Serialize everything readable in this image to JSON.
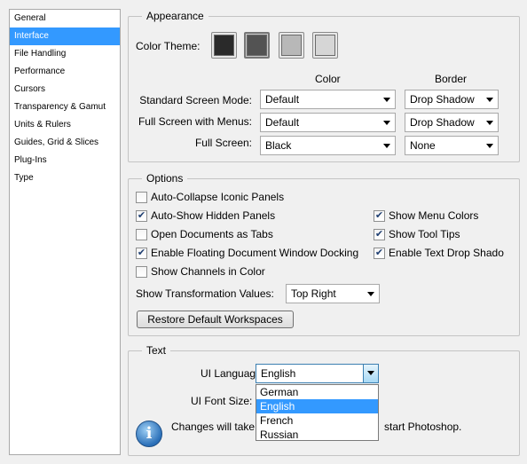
{
  "sidebar": {
    "items": [
      {
        "label": "General"
      },
      {
        "label": "Interface"
      },
      {
        "label": "File Handling"
      },
      {
        "label": "Performance"
      },
      {
        "label": "Cursors"
      },
      {
        "label": "Transparency & Gamut"
      },
      {
        "label": "Units & Rulers"
      },
      {
        "label": "Guides, Grid & Slices"
      },
      {
        "label": "Plug-Ins"
      },
      {
        "label": "Type"
      }
    ],
    "selected_index": 1
  },
  "appearance": {
    "title": "Appearance",
    "color_theme_label": "Color Theme:",
    "themes": [
      "#2a2a2a",
      "#535353",
      "#b8b8b8",
      "#d6d6d6"
    ],
    "selected_theme": 1,
    "col_color": "Color",
    "col_border": "Border",
    "rows": [
      {
        "label": "Standard Screen Mode:",
        "color": "Default",
        "border": "Drop Shadow"
      },
      {
        "label": "Full Screen with Menus:",
        "color": "Default",
        "border": "Drop Shadow"
      },
      {
        "label": "Full Screen:",
        "color": "Black",
        "border": "None"
      }
    ]
  },
  "options": {
    "title": "Options",
    "left_checks": [
      {
        "label": "Auto-Collapse Iconic Panels",
        "checked": false
      },
      {
        "label": "Auto-Show Hidden Panels",
        "checked": true
      },
      {
        "label": "Open Documents as Tabs",
        "checked": false
      },
      {
        "label": "Enable Floating Document Window Docking",
        "checked": true
      },
      {
        "label": "Show Channels in Color",
        "checked": false
      }
    ],
    "right_checks": [
      {
        "label": "Show Menu Colors",
        "checked": true
      },
      {
        "label": "Show Tool Tips",
        "checked": true
      },
      {
        "label": "Enable Text Drop Shado",
        "checked": true
      }
    ],
    "transform_label": "Show Transformation Values:",
    "transform_value": "Top Right",
    "restore_button": "Restore Default Workspaces"
  },
  "text": {
    "title": "Text",
    "ui_language_label": "UI Language:",
    "ui_language_value": "English",
    "ui_font_size_label": "UI Font Size:",
    "notice_left": "Changes will take",
    "notice_right": "start Photoshop.",
    "language_options": [
      "German",
      "English",
      "French",
      "Russian"
    ],
    "language_selected_index": 1
  },
  "colors": {
    "selection": "#3399ff",
    "info_icon": "#2a6fb8"
  }
}
